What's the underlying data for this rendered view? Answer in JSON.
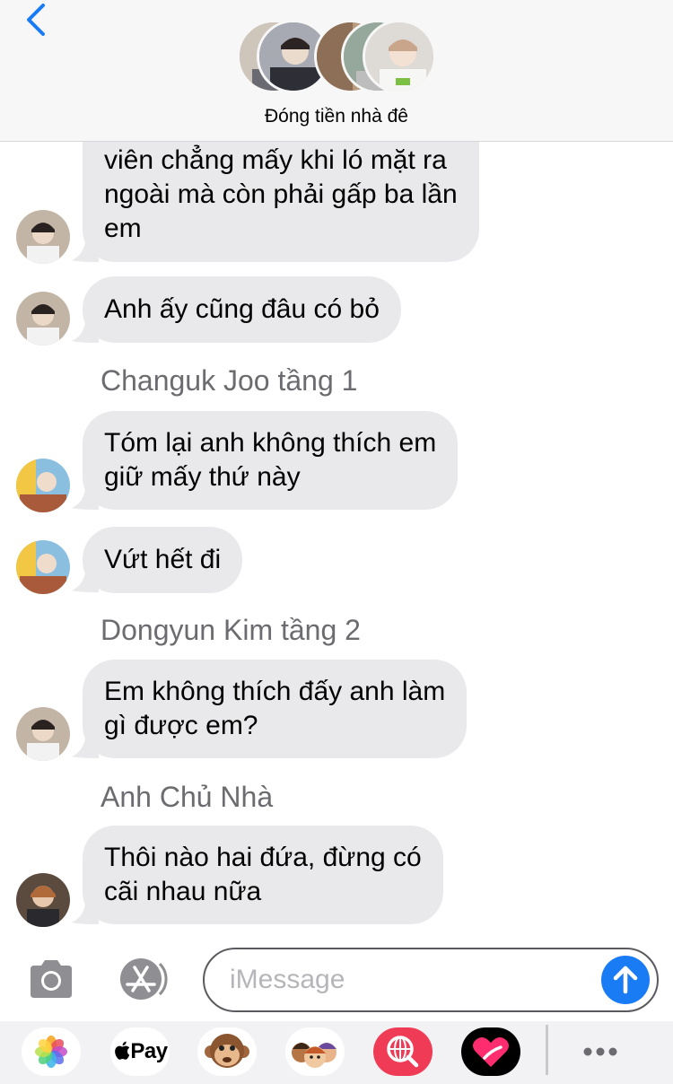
{
  "header": {
    "group_name": "Đóng tiền nhà đê",
    "back_icon": "chevron-left-icon"
  },
  "messages": [
    {
      "lines": [
        "viên chẳng mấy khi ló mặt ra",
        "ngoài mà còn phải gấp ba lần",
        "em"
      ]
    },
    {
      "lines": [
        "Anh ấy cũng đâu có bỏ"
      ]
    },
    {
      "sender": "Changuk Joo tầng 1"
    },
    {
      "lines": [
        "Tóm lại anh không thích em",
        "giữ mấy thứ này"
      ]
    },
    {
      "lines": [
        "Vứt hết đi"
      ]
    },
    {
      "sender": "Dongyun Kim tầng 2"
    },
    {
      "lines": [
        "Em không thích đấy anh làm",
        "gì được em?"
      ]
    },
    {
      "sender": "Anh Chủ Nhà"
    },
    {
      "lines": [
        "Thôi nào hai đứa, đừng có",
        "cãi nhau nữa"
      ]
    }
  ],
  "input": {
    "placeholder": "iMessage",
    "camera_icon": "camera-icon",
    "appstore_icon": "app-store-icon",
    "send_icon": "send-arrow-icon"
  },
  "apps": [
    {
      "name": "photos-app-icon"
    },
    {
      "name": "apple-pay-app-icon",
      "label": "Pay"
    },
    {
      "name": "animoji-monkey-app-icon"
    },
    {
      "name": "memoji-app-icon"
    },
    {
      "name": "web-image-search-app-icon"
    },
    {
      "name": "digital-touch-app-icon"
    },
    {
      "name": "more-apps-icon"
    }
  ],
  "colors": {
    "accent": "#1a7cf5",
    "bubble": "#e9e9eb",
    "sender_text": "#6c6c70"
  }
}
